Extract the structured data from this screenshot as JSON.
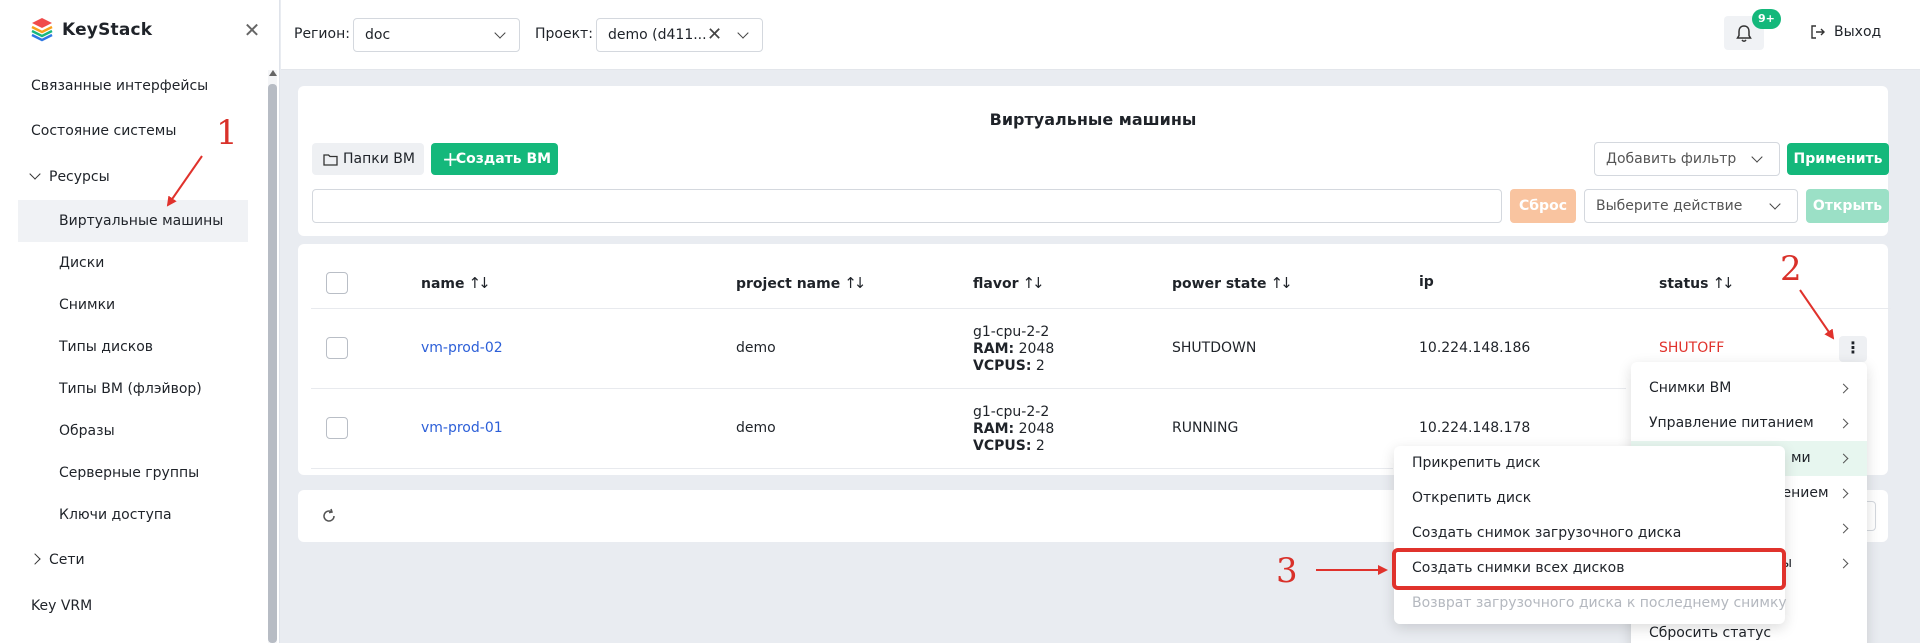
{
  "sidebar": {
    "logo_text": "KeyStack",
    "items": [
      {
        "label": "Связанные интерфейсы"
      },
      {
        "label": "Состояние системы"
      },
      {
        "label": "Ресурсы"
      },
      {
        "label": "Виртуальные машины"
      },
      {
        "label": "Диски"
      },
      {
        "label": "Снимки"
      },
      {
        "label": "Типы дисков"
      },
      {
        "label": "Типы ВМ (флэйвор)"
      },
      {
        "label": "Образы"
      },
      {
        "label": "Серверные группы"
      },
      {
        "label": "Ключи доступа"
      },
      {
        "label": "Сети"
      },
      {
        "label": "Key VRM"
      }
    ]
  },
  "header": {
    "region_label": "Регион:",
    "region_value": "doc",
    "project_label": "Проект:",
    "project_value": "demo (d411...",
    "notification_count": "9+",
    "logout_label": "Выход"
  },
  "toolbar": {
    "page_title": "Виртуальные машины",
    "folders_button": "Папки ВМ",
    "create_button": "Создать ВМ",
    "add_filter_placeholder": "Добавить фильтр",
    "apply_button": "Применить",
    "search_value": "",
    "reset_button": "Сброс",
    "action_placeholder": "Выберите действие",
    "open_button": "Открыть"
  },
  "table": {
    "columns": [
      "name",
      "project name",
      "flavor",
      "power state",
      "ip",
      "status"
    ],
    "rows": [
      {
        "name": "vm-prod-02",
        "project": "demo",
        "flavor_name": "g1-cpu-2-2",
        "ram_label": "RAM:",
        "ram": "2048",
        "vcpus_label": "VCPUS:",
        "vcpus": "2",
        "power_state": "SHUTDOWN",
        "ip": "10.224.148.186",
        "status": "SHUTOFF"
      },
      {
        "name": "vm-prod-01",
        "project": "demo",
        "flavor_name": "g1-cpu-2-2",
        "ram_label": "RAM:",
        "ram": "2048",
        "vcpus_label": "VCPUS:",
        "vcpus": "2",
        "power_state": "RUNNING",
        "ip": "10.224.148.178",
        "status": ""
      }
    ]
  },
  "context_menu": {
    "items": [
      {
        "label": "Снимки ВМ"
      },
      {
        "label": "Управление питанием"
      },
      {
        "label": "ми"
      },
      {
        "label": "цением"
      },
      {
        "label": ""
      },
      {
        "label": "ы"
      },
      {
        "label": "Сбросить статус"
      }
    ]
  },
  "submenu": {
    "items": [
      {
        "label": "Прикрепить диск"
      },
      {
        "label": "Открепить диск"
      },
      {
        "label": "Создать снимок загрузочного диска"
      },
      {
        "label": "Создать снимки всех дисков"
      },
      {
        "label": "Возврат загрузочного диска к последнему снимку"
      }
    ]
  },
  "annotations": {
    "step1": "1",
    "step2": "2",
    "step3": "3"
  },
  "colors": {
    "accent": "#14b87b",
    "annotation": "#e0322c",
    "link": "#2c5fd8"
  }
}
